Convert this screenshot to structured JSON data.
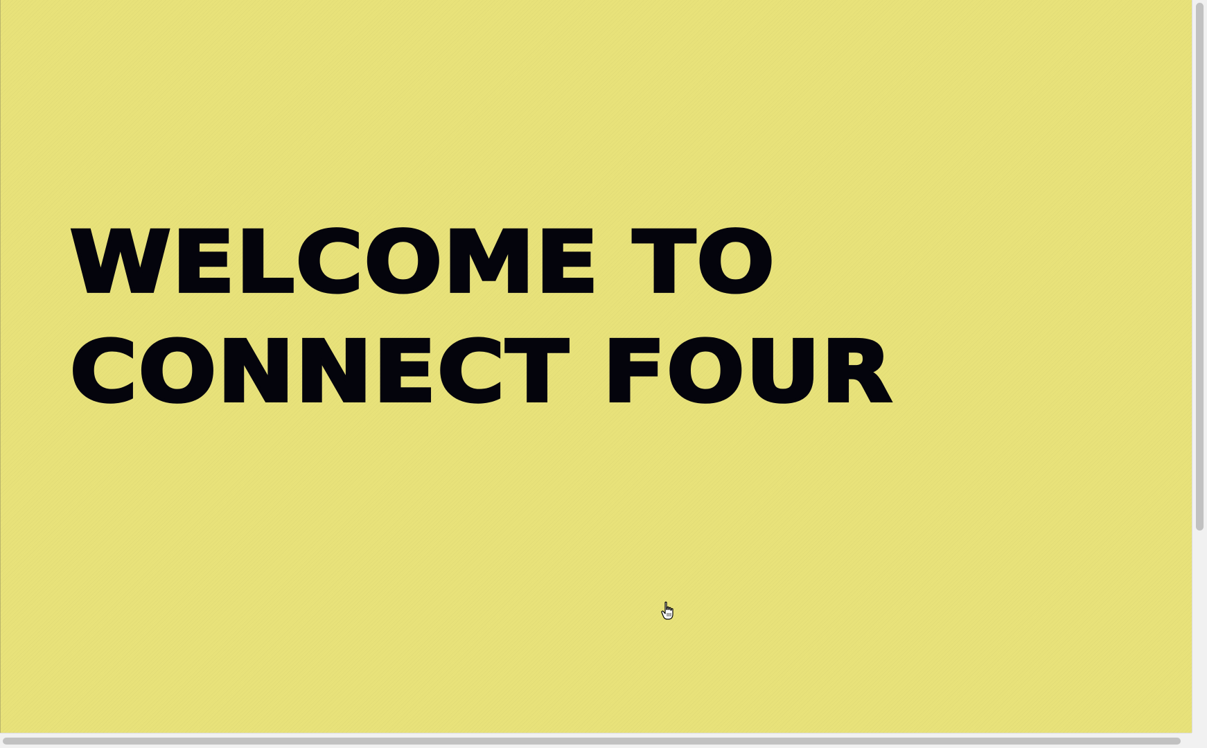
{
  "page": {
    "background_color": "#e8e27a",
    "text_color": "#04040c"
  },
  "hero": {
    "line1": "WELCOME TO",
    "line2": "CONNECT FOUR"
  },
  "cursor": {
    "icon": "hand-pointer-icon"
  },
  "scrollbars": {
    "vertical": "vertical-scrollbar",
    "horizontal": "horizontal-scrollbar"
  }
}
